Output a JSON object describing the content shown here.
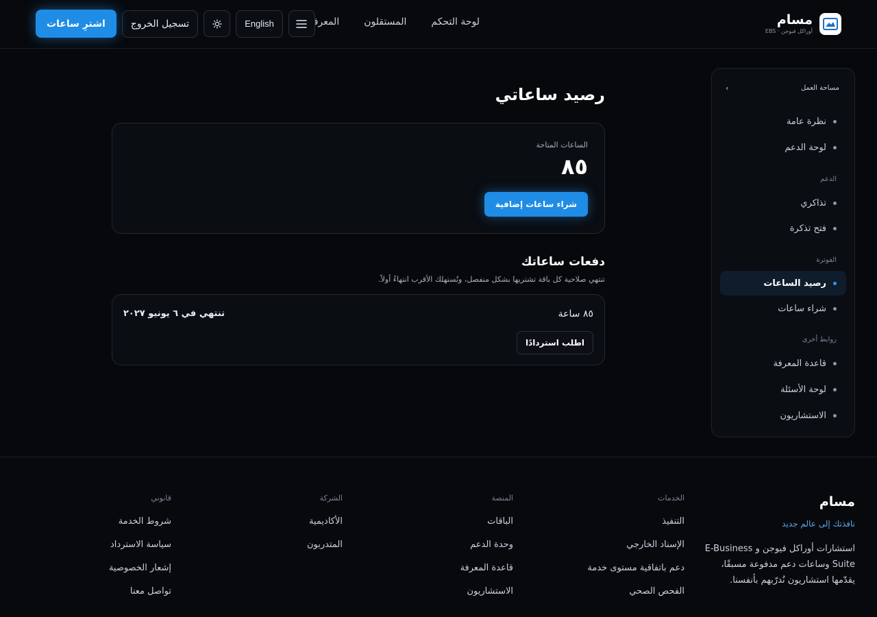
{
  "header": {
    "brand_name": "مسام",
    "brand_sub": "أوراكل فيوجن · EBS",
    "nav": [
      "لوحة التحكم",
      "المستقلون",
      "المعرفة"
    ],
    "buy_hours": "اشترِ ساعات",
    "logout": "تسجيل الخروج",
    "language": "English",
    "theme_icon": "sun-icon",
    "menu_icon": "menu-icon"
  },
  "sidebar": {
    "title": "مساحة العمل",
    "items_top": [
      "نظرة عامة",
      "لوحة الدعم"
    ],
    "section_support": "الدعم",
    "items_support": [
      "تذاكري",
      "فتح تذكرة"
    ],
    "section_billing": "الفوترة",
    "items_billing": [
      "رصيد الساعات",
      "شراء ساعات"
    ],
    "active_item": "رصيد الساعات",
    "section_other": "روابط أخرى",
    "items_other": [
      "قاعدة المعرفة",
      "لوحة الأسئلة",
      "الاستشاريون"
    ]
  },
  "main": {
    "title": "رصيد ساعاتي",
    "hours_label": "الساعات المتاحة",
    "hours_value": "٨٥",
    "buy_more": "شراء ساعات إضافية",
    "batches_title": "دفعات ساعاتك",
    "batches_sub": "تنتهي صلاحية كل باقة تشتريها بشكل منفصل، ونُستهلك الأقرب انتهاءً أولاً.",
    "batch": {
      "hours": "٨٥ ساعة",
      "expires": "تنتهي في ٦ يونيو ٢٠٢٧",
      "refund": "اطلب استردادًا"
    }
  },
  "footer": {
    "brand": "مسام",
    "tagline": "نافذتك إلى عالم جديد",
    "description": "استشارات أوراكل فيوجن و E-Business Suite وساعات دعم مدفوعة مسبقًا، يقدّمها استشاريون نُدرّبهم بأنفسنا.",
    "columns": [
      {
        "title": "الخدمات",
        "links": [
          "التنفيذ",
          "الإسناد الخارجي",
          "دعم باتفاقية مستوى خدمة",
          "الفحص الصحي"
        ]
      },
      {
        "title": "المنصة",
        "links": [
          "الباقات",
          "وحدة الدعم",
          "قاعدة المعرفة",
          "الاستشاريون"
        ]
      },
      {
        "title": "الشركة",
        "links": [
          "الأكاديمية",
          "المتدربون"
        ]
      },
      {
        "title": "قانوني",
        "links": [
          "شروط الخدمة",
          "سياسة الاسترداد",
          "إشعار الخصوصية",
          "تواصل معنا"
        ]
      }
    ]
  },
  "colors": {
    "accent": "#1f8ce6",
    "background": "#06080c",
    "card": "#0a0d12"
  }
}
